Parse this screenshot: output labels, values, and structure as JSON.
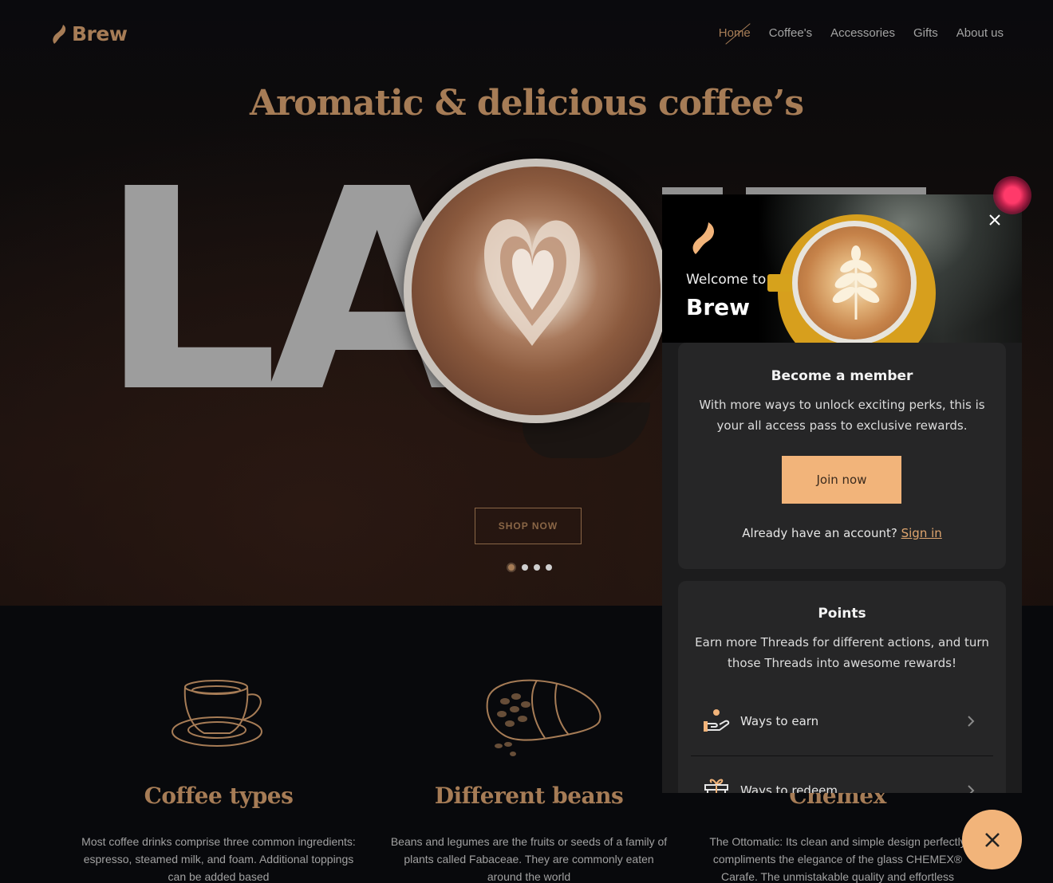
{
  "brand": {
    "name": "Brew",
    "accent_color": "#a67c56",
    "popup_accent_color": "#f2b47a"
  },
  "nav": {
    "items": [
      {
        "label": "Home",
        "active": true
      },
      {
        "label": "Coffee's",
        "active": false
      },
      {
        "label": "Accessories",
        "active": false
      },
      {
        "label": "Gifts",
        "active": false
      },
      {
        "label": "About us",
        "active": false
      }
    ]
  },
  "hero": {
    "title": "Aromatic & delicious coffee’s",
    "big_word": "LA",
    "shop_button": "SHOP NOW",
    "carousel": {
      "total": 4,
      "active_index": 0
    }
  },
  "features": [
    {
      "title": "Coffee types",
      "icon": "coffee-cup-sketch",
      "text": "Most coffee drinks comprise three common ingredients: espresso, steamed milk, and foam. Additional toppings can be added based"
    },
    {
      "title": "Different beans",
      "icon": "coffee-bean-sack-sketch",
      "text": "Beans and legumes are the fruits or seeds of a family of plants called Fabaceae. They are commonly eaten around the world"
    },
    {
      "title": "Chemex",
      "icon": "chemex-sketch",
      "text": "The Ottomatic: Its clean and simple design perfectly compliments the elegance of the glass CHEMEX® Carafe. The unmistakable quality and effortless"
    }
  ],
  "rewards_popup": {
    "welcome": "Welcome to",
    "brand": "Brew",
    "close_icon": "close-icon",
    "member_card": {
      "title": "Become a member",
      "description": "With more ways to unlock exciting perks, this is your all access pass to exclusive rewards.",
      "join_button": "Join now",
      "signin_prompt": "Already have an account?",
      "signin_link": "Sign in"
    },
    "points_card": {
      "title": "Points",
      "description": "Earn more Threads for different actions, and turn those Threads into awesome rewards!",
      "items": [
        {
          "label": "Ways to earn",
          "icon": "hand-coin-icon"
        },
        {
          "label": "Ways to redeem",
          "icon": "gift-icon"
        }
      ]
    }
  },
  "launcher": {
    "icon": "close-icon"
  }
}
